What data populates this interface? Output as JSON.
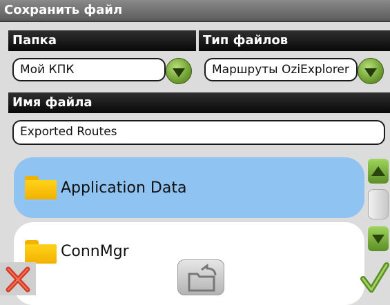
{
  "window": {
    "title": "Сохранить файл"
  },
  "folder": {
    "header": "Папка",
    "value": "Мой КПК"
  },
  "file_type": {
    "header": "Тип файлов",
    "value": "Маршруты OziExplorer"
  },
  "file_name": {
    "header": "Имя файла",
    "value": "Exported Routes"
  },
  "file_list": {
    "items": [
      {
        "label": "Application Data",
        "icon": "folder-icon",
        "selected": true
      },
      {
        "label": "ConnMgr",
        "icon": "folder-icon",
        "selected": false
      }
    ]
  },
  "toolbar": {
    "cancel_icon": "close-x-icon",
    "new_folder_icon": "new-folder-icon",
    "ok_icon": "checkmark-icon"
  },
  "colors": {
    "title_bar": "#6f6f6f",
    "header": "#111111",
    "selected_item": "#8fc3f2",
    "dropdown_green": "#6f9e32",
    "cancel_red": "#d83a2a"
  }
}
